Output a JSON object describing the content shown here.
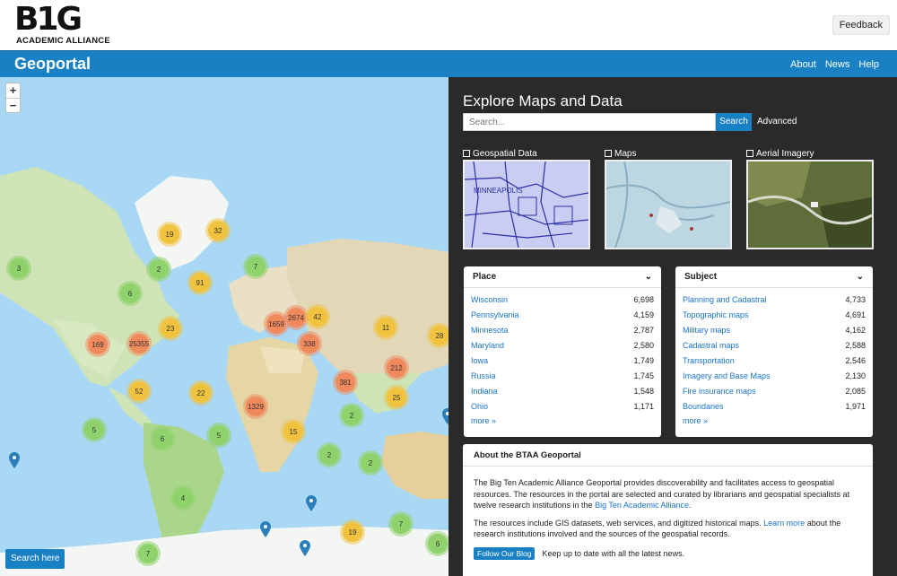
{
  "header": {
    "logo_text": "B1G",
    "logo_subtext": "ACADEMIC ALLIANCE",
    "feedback_label": "Feedback"
  },
  "nav": {
    "brand": "Geoportal",
    "links": [
      "About",
      "News",
      "Help"
    ]
  },
  "map": {
    "zoom_in": "+",
    "zoom_out": "−",
    "search_here_label": "Search here",
    "clusters": [
      "3",
      "19",
      "32",
      "2",
      "7",
      "6",
      "91",
      "1659",
      "2674",
      "42",
      "23",
      "11",
      "28",
      "169",
      "25355",
      "338",
      "212",
      "52",
      "22",
      "381",
      "25",
      "1329",
      "2",
      "5",
      "15",
      "6",
      "5",
      "2",
      "2",
      "4",
      "7",
      "19",
      "7",
      "6"
    ]
  },
  "explore": {
    "title": "Explore Maps and Data",
    "search_placeholder": "Search...",
    "search_button": "Search",
    "advanced_label": "Advanced",
    "categories": [
      {
        "label": "Geospatial Data",
        "icon": "geospatial-data-icon"
      },
      {
        "label": "Maps",
        "icon": "map-icon"
      },
      {
        "label": "Aerial Imagery",
        "icon": "aerial-imagery-icon"
      }
    ]
  },
  "place_facet": {
    "title": "Place",
    "items": [
      {
        "name": "Wisconsin",
        "count": "6,698"
      },
      {
        "name": "Pennsylvania",
        "count": "4,159"
      },
      {
        "name": "Minnesota",
        "count": "2,787"
      },
      {
        "name": "Maryland",
        "count": "2,580"
      },
      {
        "name": "Iowa",
        "count": "1,749"
      },
      {
        "name": "Russia",
        "count": "1,745"
      },
      {
        "name": "Indiana",
        "count": "1,548"
      },
      {
        "name": "Ohio",
        "count": "1,171"
      }
    ],
    "more": "more »"
  },
  "subject_facet": {
    "title": "Subject",
    "items": [
      {
        "name": "Planning and Cadastral",
        "count": "4,733"
      },
      {
        "name": "Topographic maps",
        "count": "4,691"
      },
      {
        "name": "Military maps",
        "count": "4,162"
      },
      {
        "name": "Cadastral maps",
        "count": "2,588"
      },
      {
        "name": "Transportation",
        "count": "2,546"
      },
      {
        "name": "Imagery and Base Maps",
        "count": "2,130"
      },
      {
        "name": "Fire insurance maps",
        "count": "2,085"
      },
      {
        "name": "Boundaries",
        "count": "1,971"
      }
    ],
    "more": "more »"
  },
  "about": {
    "title": "About the BTAA Geoportal",
    "p1_before": "The Big Ten Academic Alliance Geoportal provides discoverability and facilitates access to geospatial resources. The resources in the portal are selected and curated by librarians and geospatial specialists at twelve research institutions in the ",
    "p1_link": "Big Ten Academic Alliance",
    "p1_after": ".",
    "p2_before": "The resources include GIS datasets, web services, and digitized historical maps. ",
    "p2_link": "Learn more",
    "p2_after": " about the research institutions involved and the sources of the geospatial records.",
    "blog_button": "Follow Our Blog",
    "blog_text": "Keep up to date with all the latest news."
  },
  "colors": {
    "brand_blue": "#1a80c4",
    "link_blue": "#1a73c9",
    "ocean": "#a9d8f4",
    "panel_dark": "#2a2a2a"
  }
}
